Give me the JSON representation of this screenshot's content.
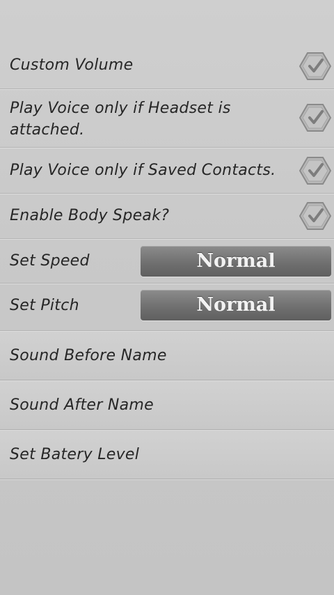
{
  "settings": {
    "custom_volume": {
      "label": "Custom Volume",
      "checked": true
    },
    "headset": {
      "label_line1": "Play Voice only if Headset is",
      "label_line2": "attached.",
      "checked": true
    },
    "saved_contacts": {
      "label": "Play Voice only if Saved Contacts.",
      "checked": true
    },
    "body_speak": {
      "label": "Enable Body Speak?",
      "checked": true
    },
    "speed": {
      "label": "Set Speed",
      "value": "Normal"
    },
    "pitch": {
      "label": "Set Pitch",
      "value": "Normal"
    },
    "sound_before": {
      "label": "Sound Before Name"
    },
    "sound_after": {
      "label": "Sound After Name"
    },
    "battery": {
      "label": "Set Batery Level"
    }
  },
  "icons": {
    "checkbox": "check-hexagon-icon"
  },
  "colors": {
    "background": "#c9c9c9",
    "button": "#707070",
    "button_text": "#f2f2f2",
    "text": "#262626"
  }
}
